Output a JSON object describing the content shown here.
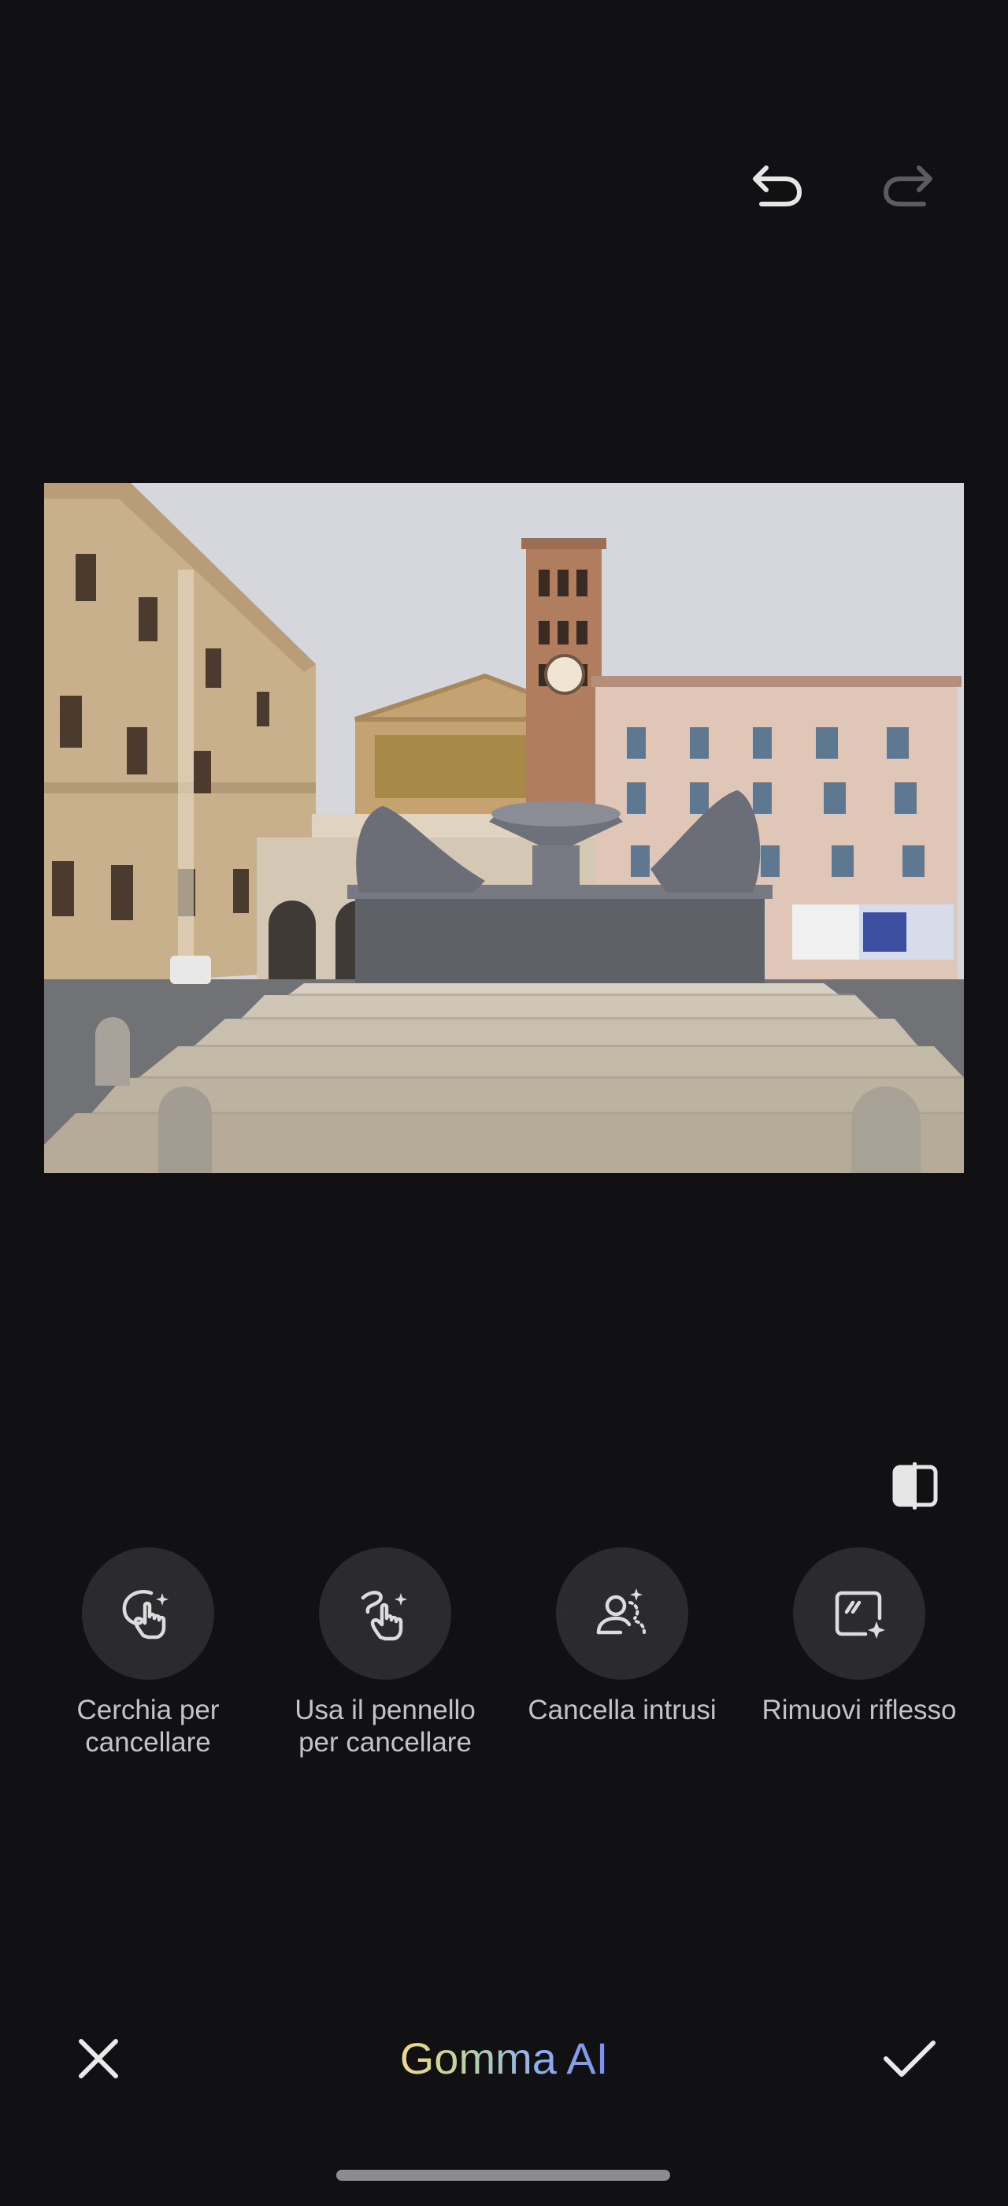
{
  "toolbar": {
    "undo_icon": "undo-icon",
    "redo_icon": "redo-icon",
    "redo_enabled": false
  },
  "photo": {
    "subject": "photo-canvas"
  },
  "compare": {
    "icon": "compare-icon"
  },
  "tools": [
    {
      "label": "Cerchia per\ncancellare",
      "icon": "circle-to-erase-icon"
    },
    {
      "label": "Usa il pennello\nper cancellare",
      "icon": "brush-erase-icon"
    },
    {
      "label": "Cancella intrusi",
      "icon": "remove-people-icon"
    },
    {
      "label": "Rimuovi riflesso",
      "icon": "remove-reflection-icon"
    }
  ],
  "bottom": {
    "title": "Gomma AI",
    "cancel_icon": "close-icon",
    "confirm_icon": "check-icon"
  },
  "colors": {
    "background": "#111113",
    "tool_circle": "#2b2b2d",
    "label": "#c4c4c6",
    "title_gradient_start": "#f0d98a",
    "title_gradient_end": "#7d8fe6"
  }
}
